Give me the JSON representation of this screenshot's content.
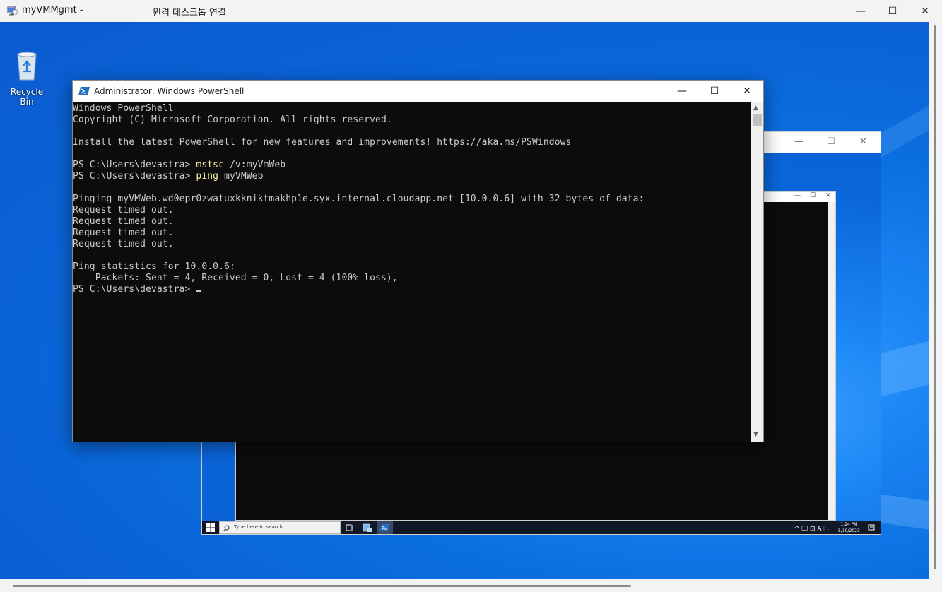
{
  "rdp_window": {
    "title": "myVMMgmt -",
    "subtitle": "원격 데스크톱 연결",
    "controls": {
      "minimize": "—",
      "maximize": "☐",
      "close": "✕"
    }
  },
  "desktop": {
    "recycle_bin_label": "Recycle Bin"
  },
  "powershell": {
    "title": "Administrator: Windows PowerShell",
    "controls": {
      "minimize": "—",
      "maximize": "☐",
      "close": "✕"
    },
    "lines": [
      {
        "text": "Windows PowerShell"
      },
      {
        "text": "Copyright (C) Microsoft Corporation. All rights reserved."
      },
      {
        "text": ""
      },
      {
        "text": "Install the latest PowerShell for new features and improvements! https://aka.ms/PSWindows"
      },
      {
        "text": ""
      },
      {
        "prompt": "PS C:\\Users\\devastra> ",
        "cmd": "mstsc",
        "args": " /v:myVmWeb"
      },
      {
        "prompt": "PS C:\\Users\\devastra> ",
        "cmd": "ping",
        "args": " myVMWeb"
      },
      {
        "text": ""
      },
      {
        "text": "Pinging myVMWeb.wd0epr0zwatuxkkniktmakhp1e.syx.internal.cloudapp.net [10.0.0.6] with 32 bytes of data:"
      },
      {
        "text": "Request timed out."
      },
      {
        "text": "Request timed out."
      },
      {
        "text": "Request timed out."
      },
      {
        "text": "Request timed out."
      },
      {
        "text": ""
      },
      {
        "text": "Ping statistics for 10.0.0.6:"
      },
      {
        "text": "    Packets: Sent = 4, Received = 0, Lost = 4 (100% loss),"
      },
      {
        "prompt": "PS C:\\Users\\devastra> ",
        "cursor": true
      }
    ]
  },
  "inner_window": {
    "controls": {
      "minimize": "—",
      "maximize": "☐",
      "close": "✕"
    },
    "taskbar": {
      "search_placeholder": "Type here to search",
      "time": "1:24 PM",
      "date": "5/19/2023",
      "tray": "^ 🖵 ⊡ A 🗔"
    }
  },
  "colors": {
    "desktop": "#0a63d6",
    "console_bg": "#0c0c0c",
    "console_text": "#cccccc",
    "command_text": "#f9f1a5"
  }
}
